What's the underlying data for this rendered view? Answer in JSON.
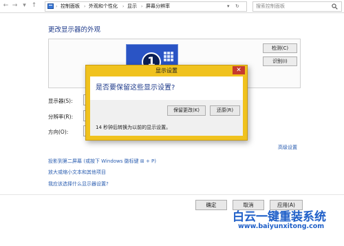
{
  "address_bar": {
    "breadcrumbs": [
      "控制面板",
      "外观和个性化",
      "显示",
      "屏幕分辨率"
    ],
    "search_placeholder": "搜索控制面板"
  },
  "main": {
    "title": "更改显示器的外观",
    "detect_label": "检测(C)",
    "identify_label": "识别(I)",
    "monitor_number": "1",
    "display_label": "显示器(S):",
    "resolution_label": "分辨率(R):",
    "orientation_label": "方向(O):",
    "advanced_link": "高级设置",
    "links": [
      "投影到第二屏幕 (或按下 Windows 徽标键 ⊞ + P)",
      "放大或缩小文本和其他项目",
      "我应该选择什么显示器设置?"
    ]
  },
  "buttons": {
    "ok": "确定",
    "cancel": "取消",
    "apply": "应用(A)"
  },
  "dialog": {
    "title": "显示设置",
    "question": "是否要保留这些显示设置?",
    "keep_label": "保留更改(K)",
    "revert_label": "还原(R)",
    "countdown": "14 秒钟后转换为以前的显示设置。"
  },
  "watermark": {
    "title": "白云一键重装系统",
    "url": "www.baiyunxitong.com"
  },
  "colors": {
    "accent_link": "#2a5db0",
    "dialog_frame": "#f0c21e",
    "close_button": "#c63a2e",
    "watermark": "#1f5fc8"
  }
}
